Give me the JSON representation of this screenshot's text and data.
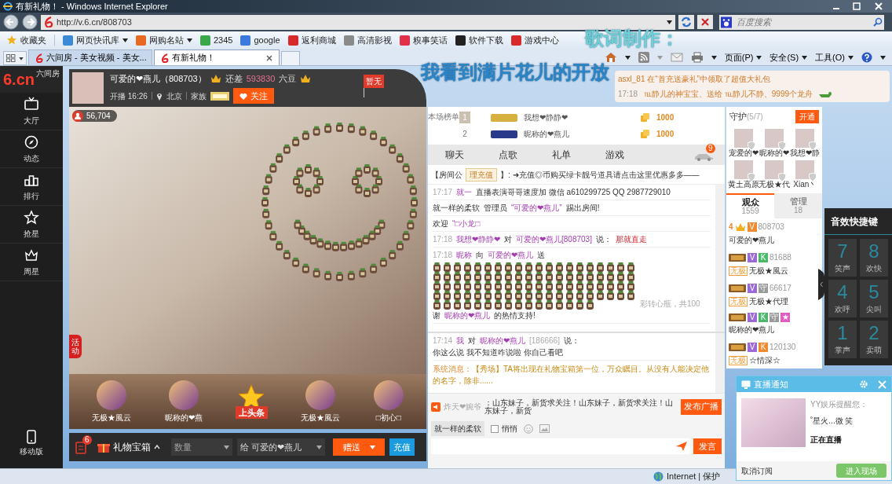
{
  "browser": {
    "title": "有新礼物！ - Windows Internet Explorer",
    "url": "http://v.6.cn/808703",
    "search_placeholder": "百度搜索",
    "favorites": [
      {
        "label": "收藏夹",
        "color": "#f0b020",
        "menu": false
      },
      {
        "label": "网页快讯库",
        "color": "#3a8ad8",
        "menu": true
      },
      {
        "label": "网购名站",
        "color": "#e86a20",
        "menu": true
      },
      {
        "label": "2345",
        "color": "#3aa84a",
        "menu": false
      },
      {
        "label": "google",
        "color": "#3a7ae0",
        "menu": false
      },
      {
        "label": "返利商城",
        "color": "#d82a2a",
        "menu": false
      },
      {
        "label": "高清影视",
        "color": "#8a8a8a",
        "menu": false
      },
      {
        "label": "糗事笑话",
        "color": "#e0304a",
        "menu": false
      },
      {
        "label": "软件下载",
        "color": "#222222",
        "menu": false
      },
      {
        "label": "游戏中心",
        "color": "#d82a2a",
        "menu": false
      }
    ],
    "tabs": [
      {
        "label": "六间房 - 美女视频 - 美女...",
        "selected": false
      },
      {
        "label": "有新礼物！",
        "selected": true
      }
    ],
    "commands": [
      "页面(P)",
      "安全(S)",
      "工具(O)"
    ],
    "status": "Internet | 保护"
  },
  "lyrics": [
    "歌词制作：",
    "我看到满片花儿的开放"
  ],
  "sidebar": {
    "logo": "6.cn",
    "logo_sub": "六间房",
    "items": [
      {
        "label": "大厅",
        "kind": "tv"
      },
      {
        "label": "动态",
        "kind": "compass"
      },
      {
        "label": "排行",
        "kind": "podium"
      },
      {
        "label": "抢星",
        "kind": "star"
      },
      {
        "label": "周星",
        "kind": "crown"
      }
    ],
    "mobile": "移动版"
  },
  "room": {
    "name": "可爱的❤燕儿（808703）",
    "remaining_label": "还差",
    "remaining": "593830",
    "currency": "六豆",
    "start": "开播 16:26",
    "city": "北京",
    "family_label": "家族",
    "follow": "关注",
    "flag": "暂无",
    "viewers": "56,704",
    "side_tab": "活动"
  },
  "gifts": [
    {
      "label": "无极★風云",
      "kind": "user"
    },
    {
      "label": "昵称的❤燕",
      "kind": "user"
    },
    {
      "label": "上头条",
      "kind": "headline"
    },
    {
      "label": "无极★風云",
      "kind": "user"
    },
    {
      "label": "□初心□",
      "kind": "user"
    }
  ],
  "gift_bar": {
    "badge": "6",
    "box": "礼物宝箱",
    "quantity_placeholder": "数量",
    "recipient": "给 可爱的❤燕儿",
    "send": "赠送",
    "recharge": "充值"
  },
  "notice": {
    "line1": "asxl_81 在“首充送豪礼”中领取了超值大礼包",
    "time": "17:18",
    "line2": "℡静儿的神宝宝、送给 ℡静儿不静、9999个龙舟"
  },
  "rank": {
    "label": "本场榜单",
    "rows": [
      {
        "rank": "1",
        "name": "我想❤静静❤",
        "amount": "1000"
      },
      {
        "rank": "2",
        "name": "昵称的❤燕儿",
        "amount": "1000"
      }
    ]
  },
  "chat_tabs": [
    "聊天",
    "点歌",
    "礼单",
    "游戏"
  ],
  "car_badge": "9",
  "announcement": {
    "prefix": "【房间公",
    "button": "理充值",
    "text": "】: ➜充值◎币购买绿卡靓号道具请点击这里优惠多多——"
  },
  "messages": [
    {
      "kind": "text",
      "time": "17:17",
      "segments": [
        {
          "text": "就一",
          "kind": "user"
        },
        {
          "text": "直播表演哥哥速度加 微信 a610299725 QQ 2987729010",
          "kind": "text"
        }
      ]
    },
    {
      "kind": "text",
      "segments": [
        {
          "text": "就一样的柔软",
          "kind": "text"
        },
        {
          "text": "管理员",
          "kind": "text"
        },
        {
          "text": "“可爱的❤燕儿”",
          "kind": "user"
        },
        {
          "text": "踢出房间!",
          "kind": "text"
        }
      ]
    },
    {
      "kind": "text",
      "segments": [
        {
          "text": "欢迎",
          "kind": "text"
        },
        {
          "text": "“□小龙□",
          "kind": "user"
        }
      ]
    },
    {
      "kind": "text",
      "time": "17:18",
      "segments": [
        {
          "text": "我想❤静静❤",
          "kind": "user"
        },
        {
          "text": "对",
          "kind": "text"
        },
        {
          "text": "可爱的❤燕儿[808703]",
          "kind": "user"
        },
        {
          "text": "说：",
          "kind": "text"
        },
        {
          "text": "那就直走",
          "kind": "alert"
        }
      ]
    },
    {
      "kind": "gift",
      "time": "17:18",
      "segments": [
        {
          "text": "昵称",
          "kind": "user"
        },
        {
          "text": "向",
          "kind": "text"
        },
        {
          "text": "可爱的❤燕儿",
          "kind": "user"
        },
        {
          "text": "送",
          "kind": "text"
        }
      ],
      "note": "彩转心瓶，共100",
      "thanks": [
        {
          "text": "谢",
          "kind": "text"
        },
        {
          "text": "昵称的❤燕儿",
          "kind": "user"
        },
        {
          "text": "的热情支持!",
          "kind": "text"
        }
      ]
    }
  ],
  "private_messages": [
    {
      "kind": "text",
      "time": "17:14",
      "segments": [
        {
          "text": "我",
          "kind": "user"
        },
        {
          "text": "对",
          "kind": "text"
        },
        {
          "text": "昵称的❤燕儿",
          "kind": "user"
        },
        {
          "text": "[186666]",
          "kind": "dim"
        },
        {
          "text": "说：",
          "kind": "text"
        },
        {
          "text": "你这么说 我不知道咋说啦 你自己看吧",
          "kind": "text"
        }
      ]
    }
  ],
  "system_message": {
    "label": "系统消息：",
    "text": "【秀场】TA将出现在礼物宝箱第一位，万众瞩目。从没有人能决定他的名字，除非......"
  },
  "broadcast": {
    "user": "炸天❤婉爷",
    "text": "：山东妹子，新货求关注！山东妹子，新货求关注！山东妹子，新货",
    "button": "发布广播"
  },
  "composer": {
    "target": "就一样的柔软",
    "whisper": {
      "label": "悄悄",
      "checked": false
    },
    "send": "发言"
  },
  "guards": {
    "title": "守护",
    "count": "(5/7)",
    "open": "开通",
    "members": [
      "宠爱的❤",
      "昵称的❤",
      "我想❤静",
      "黄土高原",
      "无极★代",
      "Xian丶"
    ]
  },
  "audience_tabs": [
    {
      "label": "观众",
      "count": "1559",
      "selected": true
    },
    {
      "label": "管理",
      "count": "18",
      "selected": false
    }
  ],
  "audience": [
    {
      "level": "4",
      "id": "808703",
      "name": "可爱的❤燕儿",
      "badges": [
        {
          "text": "V",
          "color": "#f08a30"
        }
      ]
    },
    {
      "id": "81688",
      "name": "无极★風云",
      "tag": "无极",
      "badges": [
        {
          "text": "V",
          "color": "#9a6ad6"
        },
        {
          "text": "K",
          "color": "#4cb86a"
        }
      ]
    },
    {
      "id": "66617",
      "name": "无极★代理",
      "tag": "无极",
      "badges": [
        {
          "text": "V",
          "color": "#9a6ad6"
        },
        {
          "text": "守",
          "color": "#9a9a9a"
        }
      ]
    },
    {
      "name": "昵称的❤燕儿",
      "badges": [
        {
          "text": "V",
          "color": "#9a6ad6"
        },
        {
          "text": "K",
          "color": "#4cb86a"
        },
        {
          "text": "守",
          "color": "#9a9a9a"
        },
        {
          "text": "★",
          "color": "#e060c0"
        }
      ]
    },
    {
      "id": "120130",
      "name": "☆情深☆",
      "tag": "无极",
      "badges": [
        {
          "text": "V",
          "color": "#9a6ad6"
        },
        {
          "text": "K",
          "color": "#f08a30"
        }
      ]
    }
  ],
  "sound_panel": {
    "title": "音效快捷键",
    "keys": [
      {
        "key": "7",
        "label": "笑声"
      },
      {
        "key": "8",
        "label": "欢快"
      },
      {
        "key": "4",
        "label": "欢呼"
      },
      {
        "key": "5",
        "label": "尖叫"
      },
      {
        "key": "1",
        "label": "掌声"
      },
      {
        "key": "2",
        "label": "卖萌"
      }
    ]
  },
  "popup": {
    "title": "直播通知",
    "from": "YY娱乐提醒您：",
    "streamer": "˚星火...微 笑",
    "status": "正在直播",
    "unsubscribe": "取消订阅",
    "enter": "进入现场"
  }
}
